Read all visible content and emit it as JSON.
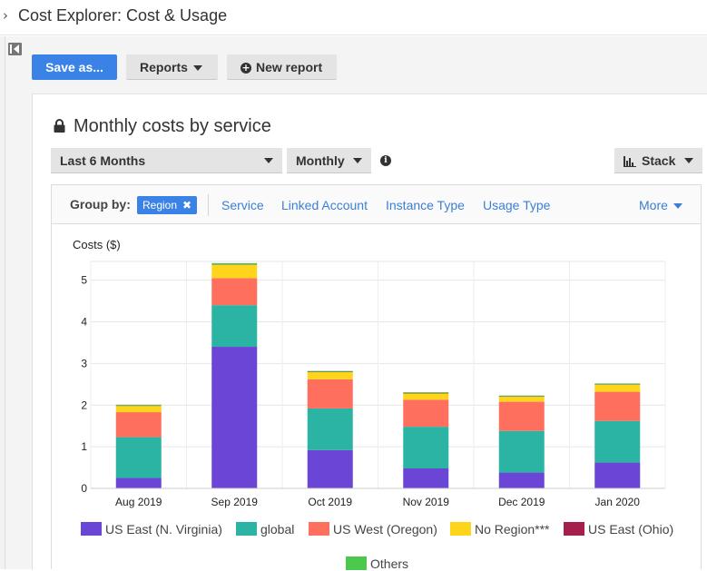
{
  "header": {
    "title": "Cost Explorer: Cost & Usage"
  },
  "toolbar": {
    "save_label": "Save as...",
    "reports_label": "Reports",
    "new_report_label": "New report"
  },
  "report": {
    "title": "Monthly costs by service",
    "time_range": "Last 6 Months",
    "granularity": "Monthly",
    "chart_style": "Stack"
  },
  "group_by": {
    "label": "Group by:",
    "selected": "Region",
    "options": [
      "Service",
      "Linked Account",
      "Instance Type",
      "Usage Type"
    ],
    "more_label": "More"
  },
  "chart_data": {
    "type": "bar",
    "stacked": true,
    "ylabel": "Costs ($)",
    "categories": [
      "Aug 2019",
      "Sep 2019",
      "Oct 2019",
      "Nov 2019",
      "Dec 2019",
      "Jan 2020"
    ],
    "ylim": [
      0,
      5.45
    ],
    "yticks": [
      0,
      1,
      2,
      3,
      4,
      5
    ],
    "grid": true,
    "legend_position": "bottom",
    "series": [
      {
        "name": "US East (N. Virginia)",
        "color": "#6a45d6",
        "values": [
          0.25,
          3.4,
          0.92,
          0.48,
          0.38,
          0.62
        ]
      },
      {
        "name": "global",
        "color": "#2bb3a3",
        "values": [
          0.98,
          1.0,
          1.0,
          1.0,
          1.0,
          1.0
        ]
      },
      {
        "name": "US West (Oregon)",
        "color": "#ff6f5e",
        "values": [
          0.6,
          0.65,
          0.7,
          0.65,
          0.7,
          0.7
        ]
      },
      {
        "name": "No Region***",
        "color": "#ffd51c",
        "values": [
          0.15,
          0.32,
          0.17,
          0.15,
          0.12,
          0.17
        ]
      },
      {
        "name": "US East (Ohio)",
        "color": "#a51f4c",
        "values": [
          0.01,
          0.01,
          0.01,
          0.01,
          0.01,
          0.01
        ]
      },
      {
        "name": "Others",
        "color": "#4cc94c",
        "values": [
          0.02,
          0.03,
          0.02,
          0.02,
          0.02,
          0.02
        ]
      }
    ]
  }
}
